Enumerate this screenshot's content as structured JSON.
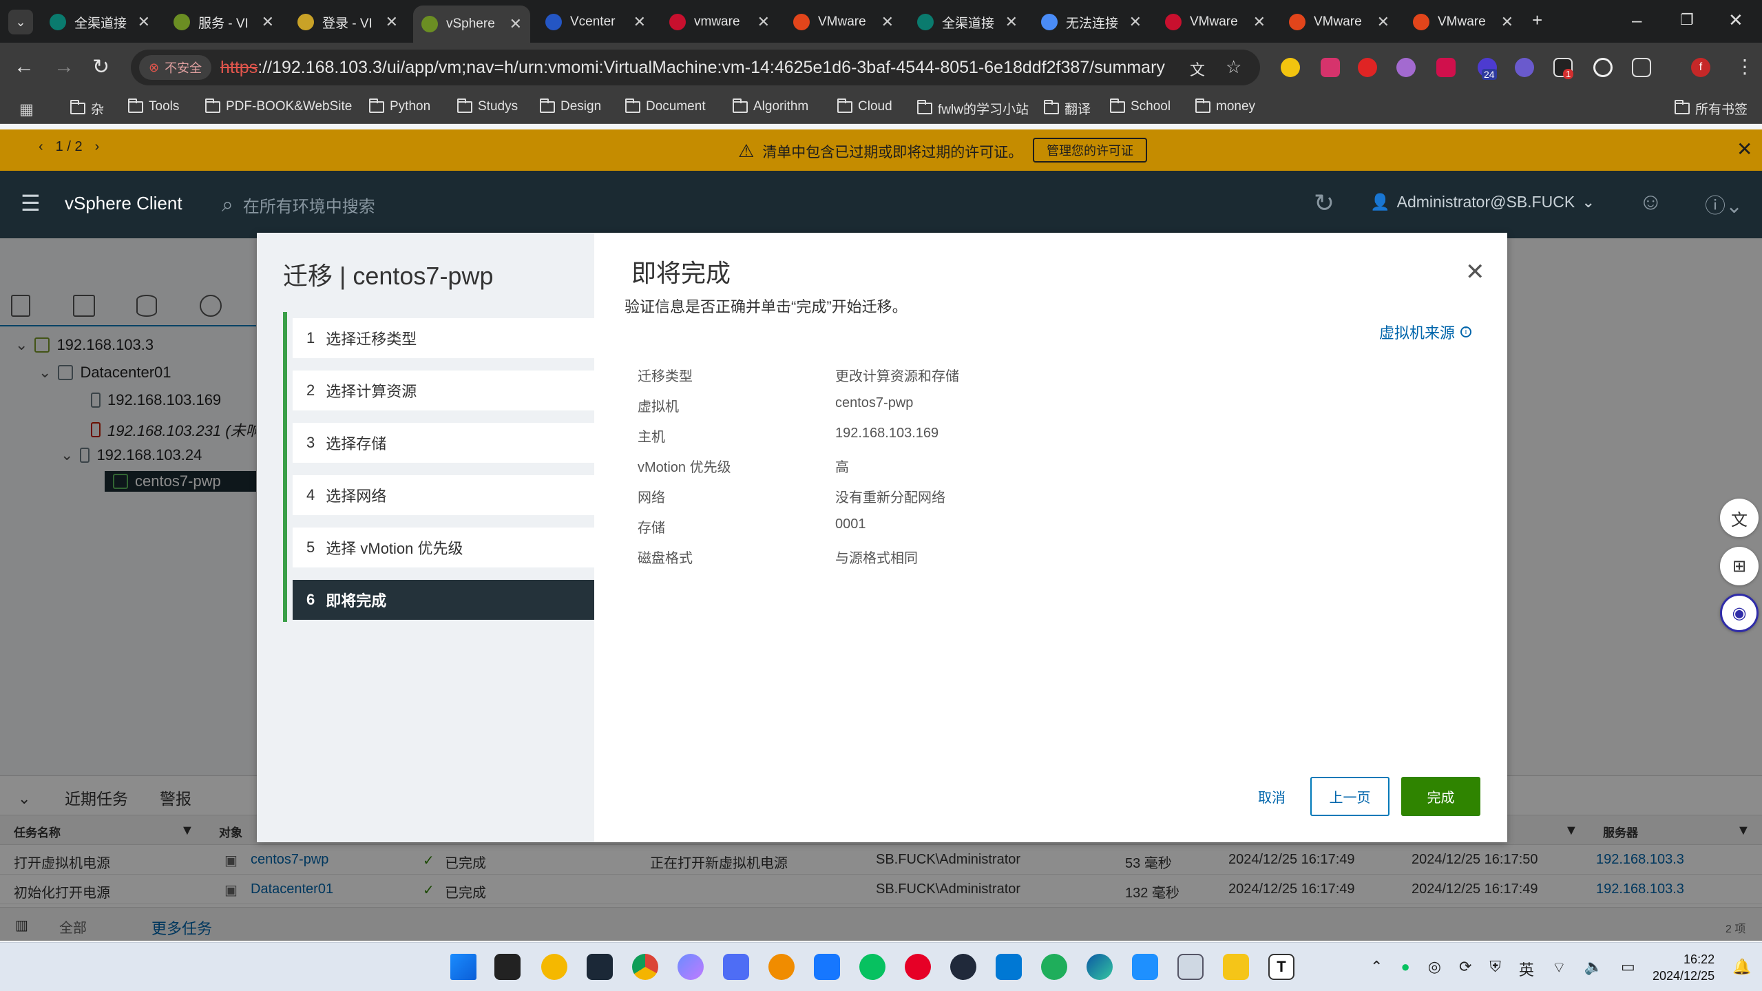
{
  "browser": {
    "tabs": [
      {
        "title": "全渠道接",
        "color": "#0a7b6e"
      },
      {
        "title": "服务 - VI",
        "color": "#6b8e23"
      },
      {
        "title": "登录 - VI",
        "color": "#c9a227"
      },
      {
        "title": "vSphere",
        "color": "#6b8e23"
      },
      {
        "title": "Vcenter",
        "color": "#2456c4"
      },
      {
        "title": "vmware",
        "color": "#c8102e"
      },
      {
        "title": "VMware",
        "color": "#e2451b"
      },
      {
        "title": "全渠道接",
        "color": "#0a7b6e"
      },
      {
        "title": "无法连接",
        "color": "#4a8cf7"
      },
      {
        "title": "VMware",
        "color": "#c8102e"
      },
      {
        "title": "VMware",
        "color": "#e2451b"
      },
      {
        "title": "VMware",
        "color": "#e2451b"
      }
    ],
    "active_tab_index": 3,
    "security_label": "不安全",
    "url_scheme": "https",
    "url_rest": "://192.168.103.3/ui/app/vm;nav=h/urn:vmomi:VirtualMachine:vm-14:4625e1d6-3baf-4544-8051-6e18ddf2f387/summary",
    "extension_badges": [
      "24",
      "1"
    ],
    "profile_initial": "f",
    "bookmarks": [
      "杂",
      "Tools",
      "PDF-BOOK&WebSite",
      "Python",
      "Studys",
      "Design",
      "Document",
      "Algorithm",
      "Cloud",
      "fwlw的学习小站",
      "翻译",
      "School",
      "money"
    ],
    "all_bookmarks": "所有书签"
  },
  "banner": {
    "pager": "1 / 2",
    "message": "清单中包含已过期或即将过期的许可证。",
    "button": "管理您的许可证"
  },
  "vsphere": {
    "title": "vSphere Client",
    "search_placeholder": "在所有环境中搜索",
    "user": "Administrator@SB.FUCK"
  },
  "inventory": [
    {
      "label": "192.168.103.3"
    },
    {
      "label": "Datacenter01"
    },
    {
      "label": "192.168.103.169"
    },
    {
      "label": "192.168.103.231 (未响"
    },
    {
      "label": "192.168.103.24"
    },
    {
      "label": "centos7-pwp"
    }
  ],
  "tasks": {
    "tabs": [
      "近期任务",
      "警报"
    ],
    "headers": {
      "name": "任务名称",
      "target": "对象",
      "server": "服务器"
    },
    "rows": [
      {
        "name": "打开虚拟机电源",
        "target": "centos7-pwp",
        "status": "已完成",
        "details": "正在打开新虚拟机电源",
        "initiator": "SB.FUCK\\Administrator",
        "queued": "53 毫秒",
        "start": "2024/12/25 16:17:49",
        "completion": "2024/12/25 16:17:50",
        "server": "192.168.103.3"
      },
      {
        "name": "初始化打开电源",
        "target": "Datacenter01",
        "status": "已完成",
        "details": "",
        "initiator": "SB.FUCK\\Administrator",
        "queued": "132 毫秒",
        "start": "2024/12/25 16:17:49",
        "completion": "2024/12/25 16:17:49",
        "server": "192.168.103.3"
      }
    ],
    "filter": "全部",
    "more": "更多任务",
    "count": "2 项"
  },
  "wizard": {
    "title": "迁移 | centos7-pwp",
    "steps": [
      {
        "num": "1",
        "label": "选择迁移类型"
      },
      {
        "num": "2",
        "label": "选择计算资源"
      },
      {
        "num": "3",
        "label": "选择存储"
      },
      {
        "num": "4",
        "label": "选择网络"
      },
      {
        "num": "5",
        "label": "选择 vMotion 优先级"
      },
      {
        "num": "6",
        "label": "即将完成"
      }
    ],
    "active_step": 6,
    "section_title": "即将完成",
    "section_subtitle": "验证信息是否正确并单击“完成”开始迁移。",
    "vm_source_link": "虚拟机来源",
    "summary": [
      {
        "label": "迁移类型",
        "value": "更改计算资源和存储"
      },
      {
        "label": "虚拟机",
        "value": "centos7-pwp"
      },
      {
        "label": "主机",
        "value": "192.168.103.169"
      },
      {
        "label": "vMotion 优先级",
        "value": "高"
      },
      {
        "label": "网络",
        "value": "没有重新分配网络"
      },
      {
        "label": "存储",
        "value": "0001"
      },
      {
        "label": "磁盘格式",
        "value": "与源格式相同"
      }
    ],
    "buttons": {
      "cancel": "取消",
      "back": "上一页",
      "finish": "完成"
    }
  },
  "taskbar": {
    "time": "16:22",
    "date": "2024/12/25",
    "ime": "英"
  }
}
